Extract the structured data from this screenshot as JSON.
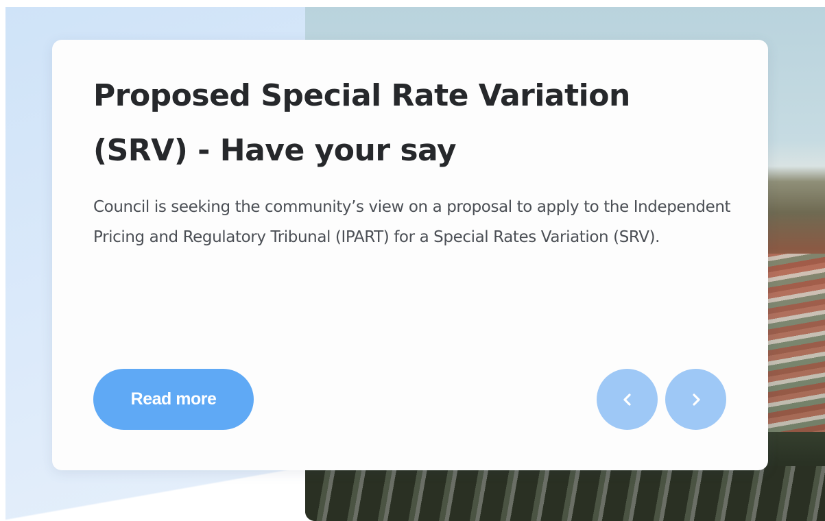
{
  "slide": {
    "title": "Proposed Special Rate Variation (SRV) - Have your say",
    "description": "Council is seeking the community’s view on a proposal to apply to the Independent Pricing and Regulatory Tribunal (IPART) for a Special Rates Variation (SRV).",
    "read_more_label": "Read more",
    "prev_icon": "chevron-left-icon",
    "next_icon": "chevron-right-icon"
  },
  "colors": {
    "button_primary": "#5fa9f5",
    "nav_button": "#9ec8f6",
    "title_text": "#26282b",
    "body_text": "#4b4f55",
    "panel_blue": "#d6e7f9"
  }
}
